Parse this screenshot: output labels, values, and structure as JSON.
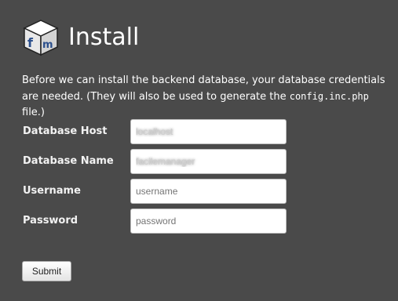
{
  "header": {
    "title": "Install",
    "logo_icon": "fm-cube-logo-icon"
  },
  "intro": {
    "text_before": "Before we can install the backend database, your database credentials are needed. (They will also be used to generate the ",
    "filename": "config.inc.php",
    "text_after": " file.)"
  },
  "form": {
    "fields": [
      {
        "label": "Database Host",
        "value": "localhost",
        "placeholder": ""
      },
      {
        "label": "Database Name",
        "value": "facilemanager",
        "placeholder": ""
      },
      {
        "label": "Username",
        "value": "",
        "placeholder": "username"
      },
      {
        "label": "Password",
        "value": "",
        "placeholder": "password"
      }
    ],
    "submit_label": "Submit"
  },
  "colors": {
    "background": "#4a4a4a",
    "text": "#ffffff",
    "logo_cube": "#f2f2f2",
    "logo_letters": "#2b4f8c"
  }
}
